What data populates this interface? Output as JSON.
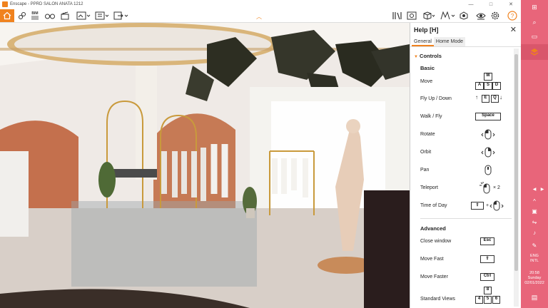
{
  "window": {
    "title": "Enscape - PPRD SALON ANATA 1212",
    "minimize": "—",
    "maximize": "□",
    "close": "✕"
  },
  "toolbar": {
    "accent_color": "#f0821e",
    "left_tools": [
      "home-icon",
      "link-icon",
      "bim-icon",
      "binoculars-icon",
      "clapper-icon",
      "screenshot-icon",
      "video-icon",
      "export-icon"
    ],
    "bim_label": "BIM",
    "right_tools": [
      "library-icon",
      "render-icon",
      "box-icon",
      "map-icon",
      "grid-icon",
      "eye-icon",
      "settings-icon",
      "help-icon"
    ]
  },
  "help_panel": {
    "title": "Help [H]",
    "tabs": [
      "General",
      "Home Mode"
    ],
    "active_tab": "General",
    "section_controls": "Controls",
    "subsection_basic": "Basic",
    "basic": [
      {
        "label": "Move",
        "keys_top": "W",
        "keys": [
          "A",
          "S",
          "D"
        ]
      },
      {
        "label": "Fly Up / Down",
        "keys": [
          "E",
          "Q"
        ]
      },
      {
        "label": "Walk / Fly",
        "keys": [
          "Space"
        ]
      },
      {
        "label": "Rotate",
        "icon": "mouse-left-icon"
      },
      {
        "label": "Orbit",
        "icon": "mouse-right-icon"
      },
      {
        "label": "Pan",
        "icon": "mouse-middle-icon"
      },
      {
        "label": "Teleport",
        "icon": "mouse-double-click-icon",
        "suffix": "× 2"
      },
      {
        "label": "Time of Day",
        "icon": "shift-mouse-icon",
        "plus": "+"
      }
    ],
    "subsection_advanced": "Advanced",
    "advanced": [
      {
        "label": "Close window",
        "keys": [
          "Esc"
        ]
      },
      {
        "label": "Move Fast",
        "keys": [
          "⇧"
        ]
      },
      {
        "label": "Move Faster",
        "keys": [
          "Ctrl"
        ]
      },
      {
        "label": "Standard Views",
        "keys_top": "8",
        "keys": [
          "4",
          "5",
          "6"
        ]
      }
    ]
  },
  "taskbar": {
    "color": "#e8657a",
    "language": "ENG",
    "layout": "INTL",
    "time": "20:58",
    "day": "Sunday",
    "date": "02/01/2022"
  }
}
